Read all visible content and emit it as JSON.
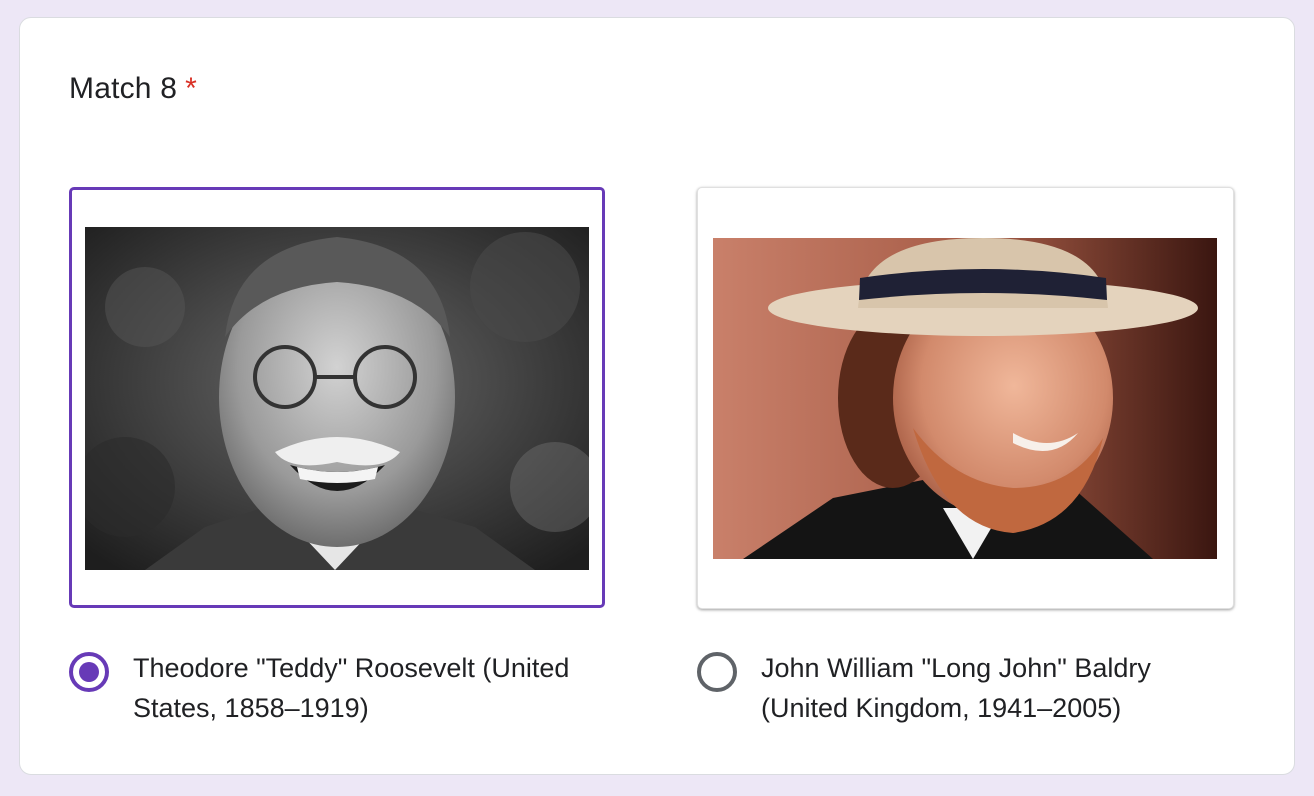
{
  "question": {
    "title": "Match 8",
    "required_marker": "*"
  },
  "options": [
    {
      "label": "Theodore \"Teddy\" Roosevelt (United States, 1858–1919)",
      "selected": true
    },
    {
      "label": "John William \"Long John\" Baldry (United Kingdom, 1941–2005)",
      "selected": false
    }
  ],
  "colors": {
    "accent": "#673ab7",
    "background": "#ede7f6",
    "required": "#d93025"
  }
}
